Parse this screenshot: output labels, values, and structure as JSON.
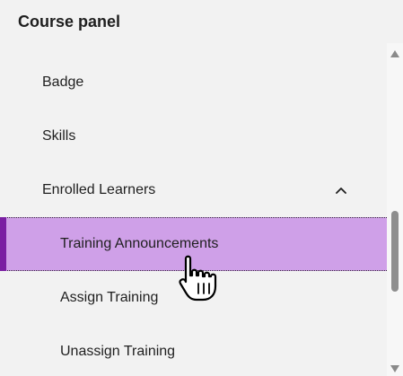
{
  "panel": {
    "title": "Course panel"
  },
  "nav": {
    "items": [
      {
        "label": "Badge"
      },
      {
        "label": "Skills"
      },
      {
        "label": "Enrolled Learners"
      },
      {
        "label": "Training Announcements"
      },
      {
        "label": "Assign Training"
      },
      {
        "label": "Unassign Training"
      }
    ],
    "expanded_section": "Enrolled Learners",
    "active_item": "Training Announcements"
  },
  "icons": {
    "expand": "chevron-up-icon",
    "scroll_up": "triangle-up-icon",
    "scroll_down": "triangle-down-icon",
    "cursor": "hand-pointer-icon"
  },
  "colors": {
    "background": "#f2f2f2",
    "active_background": "#cfa0e8",
    "active_accent": "#7a1fa2",
    "text": "#1f1f1f",
    "scroll_thumb": "#8e8e8e"
  }
}
